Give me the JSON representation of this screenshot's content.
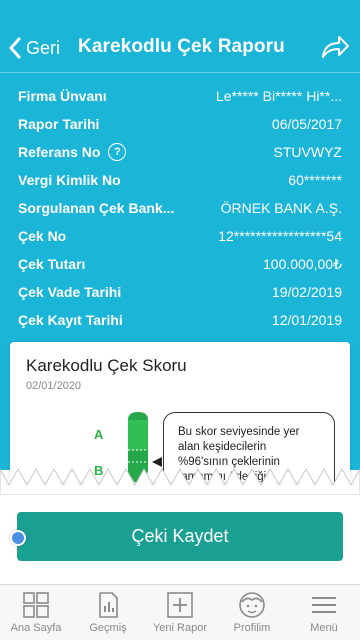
{
  "nav": {
    "back_label": "Geri",
    "title": "Karekodlu Çek Raporu"
  },
  "details": [
    {
      "label": "Firma Ünvanı",
      "value": "Le***** Bi***** Hi**..."
    },
    {
      "label": "Rapor Tarihi",
      "value": "06/05/2017"
    },
    {
      "label": "Referans No",
      "value": "STUVWYZ"
    },
    {
      "label": "Vergi Kimlik No",
      "value": "60*******"
    },
    {
      "label": "Sorgulanan Çek Bank...",
      "value": "ÖRNEK BANK A.Ş."
    },
    {
      "label": "Çek No",
      "value": "12*****************54"
    },
    {
      "label": "Çek Tutarı",
      "value": "100.000,00₺"
    },
    {
      "label": "Çek Vade Tarihi",
      "value": "19/02/2019"
    },
    {
      "label": "Çek Kayıt Tarihi",
      "value": "12/01/2019"
    }
  ],
  "info_icon_glyph": "?",
  "score_card": {
    "title": "Karekodlu Çek Skoru",
    "date": "02/01/2020",
    "grades": [
      "A",
      "B"
    ],
    "current_grade": "B",
    "bubble_lines": [
      "Bu skor seviyesinde yer",
      "alan keşidecilerin",
      "%96'sının çeklerinin",
      "tamamını ödediği"
    ]
  },
  "save_button": "Çeki Kaydet",
  "tabs": [
    {
      "label": "Ana Sayfa",
      "icon": "home-grid-icon"
    },
    {
      "label": "Geçmiş",
      "icon": "history-chart-icon"
    },
    {
      "label": "Yeni Rapor",
      "icon": "plus-box-icon"
    },
    {
      "label": "Profilim",
      "icon": "profile-face-icon"
    },
    {
      "label": "Menü",
      "icon": "hamburger-menu-icon"
    }
  ],
  "colors": {
    "header_bg": "#1bb5d8",
    "button_bg": "#1aa093",
    "grade_green": "#2db34a"
  }
}
